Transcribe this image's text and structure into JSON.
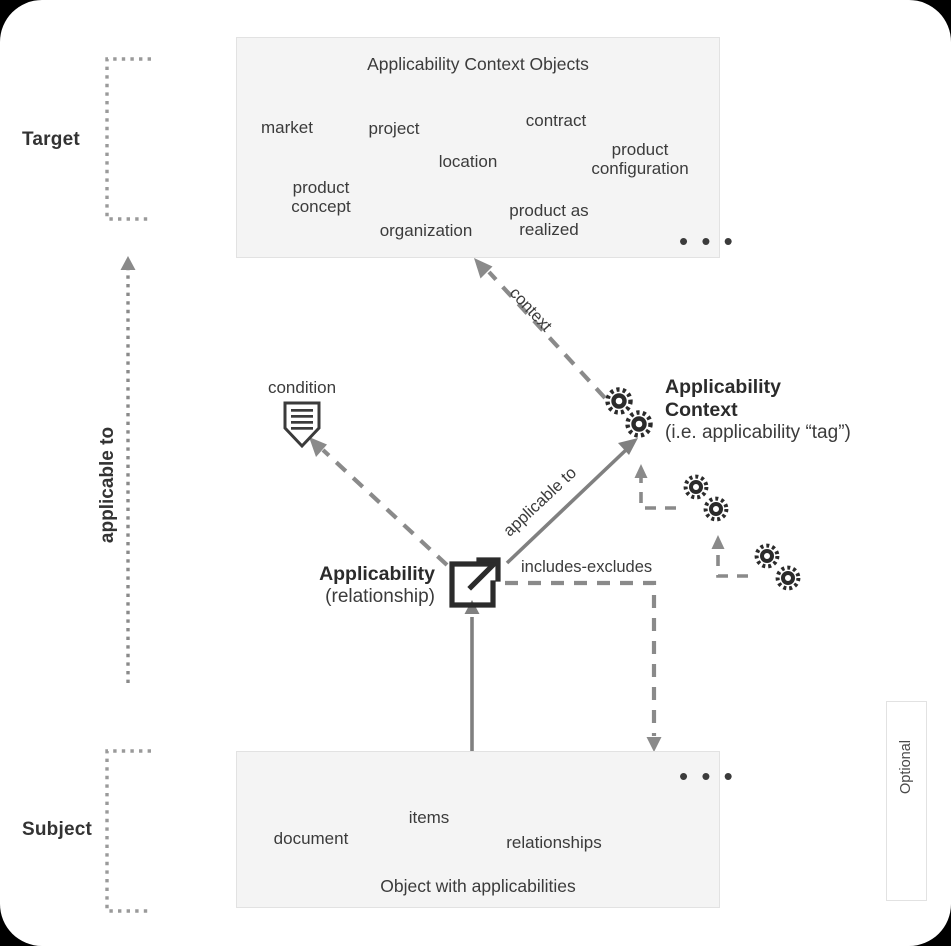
{
  "diagram": {
    "title": "Applicability Context Objects diagram",
    "colors": {
      "panel_fill": "#f4f4f4",
      "panel_border": "#e2e2e2",
      "icon_stroke": "#3b3b3b",
      "dashed_gray": "#8a8a8a",
      "solid_gray": "#808080",
      "bracket_gray": "#9a9a9a",
      "text_dark": "#2b2b2b",
      "page_bg": "#ffffff",
      "outside_bg": "#000000"
    }
  },
  "side_labels": {
    "target": "Target",
    "subject": "Subject",
    "axis": "applicable to"
  },
  "target_panel": {
    "title": "Applicability Context Objects",
    "ellipsis": "• • •",
    "items": [
      {
        "label": "market",
        "icon": "pie-chart-icon"
      },
      {
        "label": "project",
        "icon": "project-gantt-icon"
      },
      {
        "label": "contract",
        "icon": "contract-signature-icon"
      },
      {
        "label": "product\nconfiguration",
        "icon": "double-gear-icon"
      },
      {
        "label": "location",
        "icon": "map-pin-icon"
      },
      {
        "label": "product\nconcept",
        "icon": "lightbulb-icon"
      },
      {
        "label": "organization",
        "icon": "building-icon"
      },
      {
        "label": "product as\nrealized",
        "icon": "barcode-icon"
      }
    ]
  },
  "subject_panel": {
    "title": "Object with applicabilities",
    "ellipsis": "• • •",
    "items": [
      {
        "label": "document",
        "icon": "document-icon"
      },
      {
        "label": "items",
        "icon": "gear-icon"
      },
      {
        "label": "relationships",
        "icon": "relationships-icon"
      }
    ]
  },
  "nodes": {
    "condition": {
      "label": "condition",
      "icon": "condition-shield-icon"
    },
    "applicability": {
      "title": "Applicability",
      "subtitle": "(relationship)",
      "icon": "external-link-square-icon"
    },
    "applicability_context": {
      "title_line1": "Applicability",
      "title_line2": "Context",
      "subtitle": "(i.e. applicability “tag”)",
      "icon": "double-gear-icon"
    },
    "tag_2": {
      "icon": "double-gear-icon"
    },
    "tag_3": {
      "icon": "double-gear-icon"
    }
  },
  "edges": {
    "context": "context",
    "applicable_to": "applicable to",
    "includes_excludes": "includes-excludes"
  },
  "legend": {
    "optional": "Optional"
  }
}
